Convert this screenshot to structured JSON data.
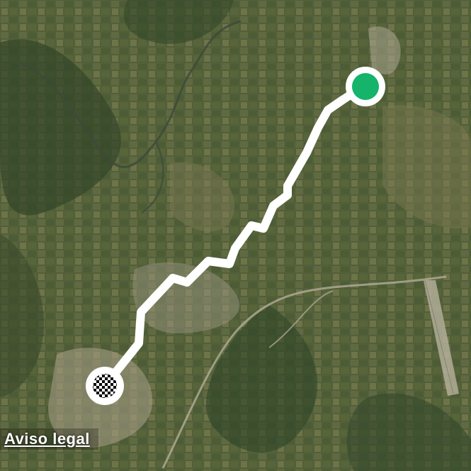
{
  "map": {
    "type": "satellite",
    "route": {
      "line_color": "#ffffff",
      "start_marker": {
        "icon": "start-point-icon",
        "color": "#16b36a"
      },
      "end_marker": {
        "icon": "checkered-finish-flag-icon"
      }
    }
  },
  "footer": {
    "legal_link_label": "Aviso legal"
  }
}
